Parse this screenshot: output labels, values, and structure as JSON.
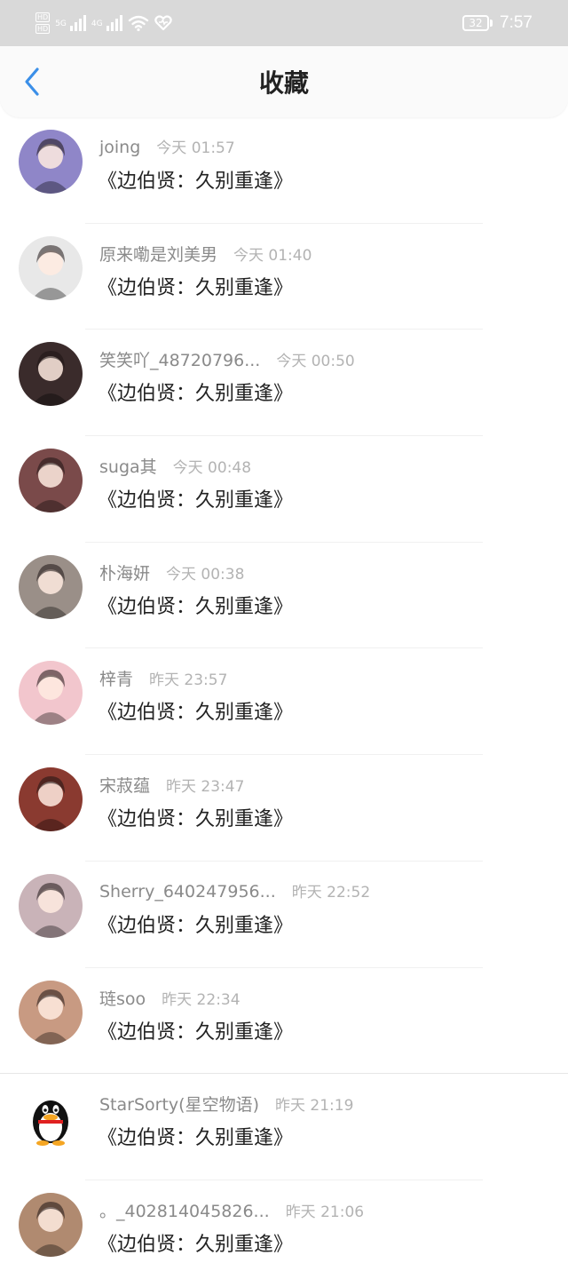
{
  "status_bar": {
    "hd_labels": [
      "HD",
      "HD"
    ],
    "network_5g": "5G",
    "network_4g": "4G",
    "battery": "32",
    "time": "7:57"
  },
  "header": {
    "title": "收藏",
    "back_icon": "chevron-left-icon"
  },
  "favorites": [
    {
      "name": "joing",
      "time": "今天 01:57",
      "content": "《边伯贤：久别重逢》",
      "avatar_color": "#8f86c8"
    },
    {
      "name": "原来嘞是刘美男",
      "time": "今天 01:40",
      "content": "《边伯贤：久别重逢》",
      "avatar_color": "#e8e8e8"
    },
    {
      "name": "笑笑吖_48720796...",
      "time": "今天 00:50",
      "content": "《边伯贤：久别重逢》",
      "avatar_color": "#3a2b2b"
    },
    {
      "name": "suga其",
      "time": "今天 00:48",
      "content": "《边伯贤：久别重逢》",
      "avatar_color": "#7a4a4a"
    },
    {
      "name": "朴海妍",
      "time": "今天 00:38",
      "content": "《边伯贤：久别重逢》",
      "avatar_color": "#9a8f88"
    },
    {
      "name": "梓青",
      "time": "昨天 23:57",
      "content": "《边伯贤：久别重逢》",
      "avatar_color": "#f2c6cd"
    },
    {
      "name": "宋菽蕴",
      "time": "昨天 23:47",
      "content": "《边伯贤：久别重逢》",
      "avatar_color": "#8a3a30"
    },
    {
      "name": "Sherry_640247956...",
      "time": "昨天 22:52",
      "content": "《边伯贤：久别重逢》",
      "avatar_color": "#c9b3b8"
    },
    {
      "name": "琏soo",
      "time": "昨天 22:34",
      "content": "《边伯贤：久别重逢》",
      "avatar_color": "#c89a82"
    },
    {
      "name": "StarSorty(星空物语)",
      "time": "昨天 21:19",
      "content": "《边伯贤：久别重逢》",
      "avatar_color": "#ffffff"
    },
    {
      "name": "。_402814045826...",
      "time": "昨天 21:06",
      "content": "《边伯贤：久别重逢》",
      "avatar_color": "#b08a70"
    }
  ]
}
